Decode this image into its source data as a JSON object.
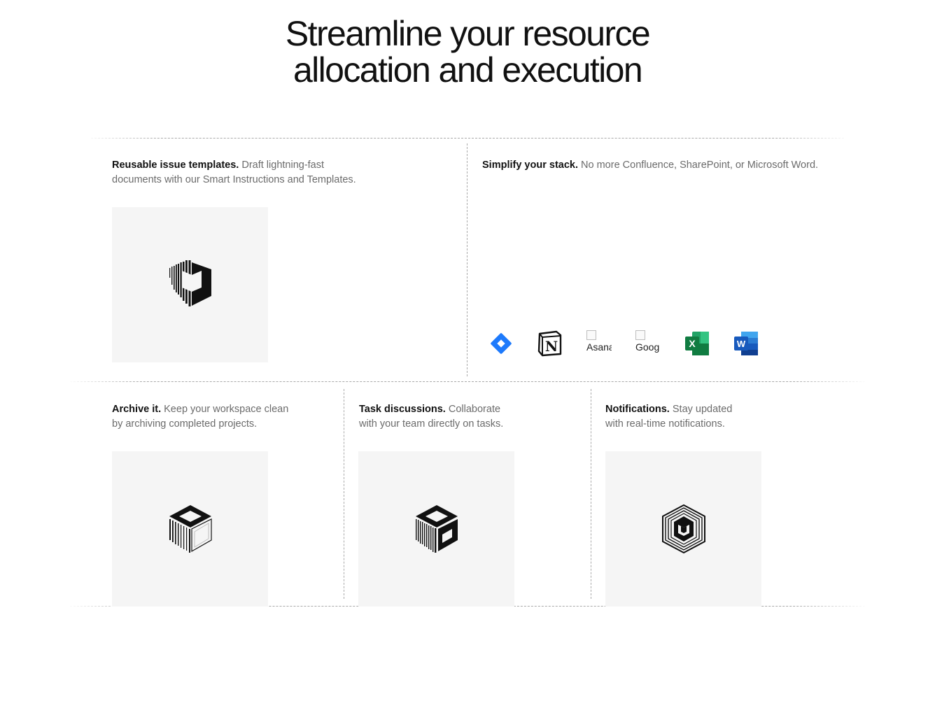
{
  "headline": {
    "line1": "Streamline your resource",
    "line2": "allocation and execution"
  },
  "features": {
    "templates": {
      "title": "Reusable issue templates.",
      "line1": "Draft lightning-fast",
      "line2": "documents with our Smart Instructions and Templates.",
      "icon": "shield-logo-icon"
    },
    "stack": {
      "title": "Simplify your stack.",
      "line1": "No more Confluence, SharePoint, or Microsoft Word.",
      "logos": [
        {
          "name": "jira-logo-icon",
          "color": "#1d7afc"
        },
        {
          "name": "notion-logo-icon",
          "color": "#111111"
        },
        {
          "name": "asana-logo-broken-image",
          "alt": "Asana"
        },
        {
          "name": "google-logo-broken-image",
          "alt": "Google"
        },
        {
          "name": "excel-logo-icon",
          "color": "#1d7044"
        },
        {
          "name": "word-logo-icon",
          "color": "#185abd"
        }
      ],
      "asana_alt": "Asana",
      "google_alt": "Goog"
    },
    "archive": {
      "title": "Archive it.",
      "line1": "Keep your workspace clean",
      "line2": "by archiving completed projects.",
      "icon": "cube-outline-icon"
    },
    "discussions": {
      "title": "Task discussions.",
      "line1": "Collaborate",
      "line2": "with your team directly on tasks.",
      "icon": "cube-solid-icon"
    },
    "notifications": {
      "title": "Notifications.",
      "line1": "Stay updated",
      "line2": "with real-time notifications.",
      "icon": "hex-logo-icon"
    }
  },
  "colors": {
    "tile_bg": "#f5f5f5",
    "divider": "#a9a9a9",
    "muted_text": "#6b6b6b",
    "text": "#111111"
  }
}
